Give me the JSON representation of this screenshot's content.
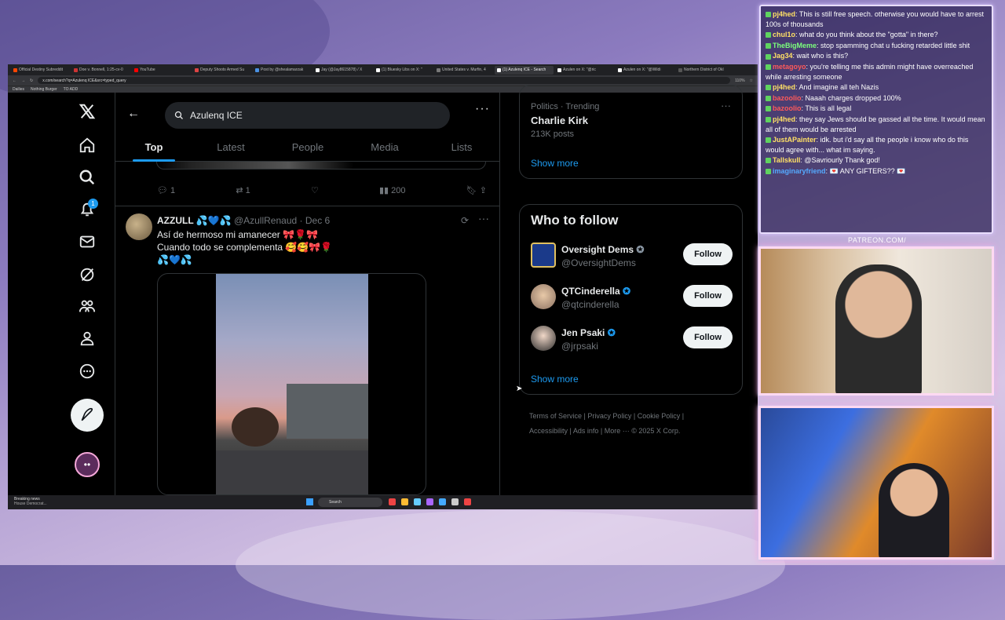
{
  "browser": {
    "tabs": [
      "Official Destiny Subreddit",
      "Doe v. Bonnell, 1:25-cv-0",
      "YouTube",
      "Deputy Shoots Armed Su",
      "Post by @shealamarzak",
      "Jay (@Jay8615878) / X",
      "(1) Bluesky Libs on X: \"",
      "United States v. Murfin, 4",
      "(1) Azulenq ICE - Search",
      "Azulen on X: \"@ric",
      "Azulen on X: \"@Wildi",
      "Northern District of Okl"
    ],
    "active_tab": 8,
    "url": "x.com/search?q=Azulenq ICE&src=typed_query",
    "zoom": "110%",
    "bookmarks": [
      "Dailies",
      "Nothing Burger",
      "TO ADD"
    ]
  },
  "nav": {
    "notification_count": "1"
  },
  "search": {
    "query": "Azulenq ICE"
  },
  "tabs": [
    "Top",
    "Latest",
    "People",
    "Media",
    "Lists"
  ],
  "prev_post": {
    "replies": "1",
    "reposts": "1",
    "views": "200"
  },
  "post": {
    "name": "AZZULL 💦💙💦",
    "handle": "@AzullRenaud",
    "date": "Dec 6",
    "line1": "Así de hermoso mi amanecer 🎀🌹🎀",
    "line2": "Cuando todo se complementa 🥰🥰🎀🌹",
    "line3": "💦💙💦"
  },
  "trending": {
    "meta": "Politics · Trending",
    "topic": "Charlie Kirk",
    "posts": "213K posts",
    "show_more": "Show more"
  },
  "who_to_follow": {
    "title": "Who to follow",
    "accounts": [
      {
        "name": "Oversight Dems",
        "handle": "@OversightDems",
        "button": "Follow"
      },
      {
        "name": "QTCinderella",
        "handle": "@qtcinderella",
        "button": "Follow"
      },
      {
        "name": "Jen Psaki",
        "handle": "@jrpsaki",
        "button": "Follow"
      }
    ],
    "show_more": "Show more"
  },
  "footer": {
    "links": [
      "Terms of Service",
      "Privacy Policy",
      "Cookie Policy",
      "Accessibility",
      "Ads info",
      "More ···"
    ],
    "copyright": "© 2025 X Corp."
  },
  "taskbar": {
    "news_title": "Breaking news",
    "news_sub": "House Democrat...",
    "search": "Search"
  },
  "chat": [
    {
      "user": "pj4hed",
      "color": "#ffe066",
      "text": "This is still free speech. otherwise you would have to arrest 100s of thousands"
    },
    {
      "user": "chul1o",
      "color": "#ffe066",
      "text": "what do you think about the \"gotta\" in there?"
    },
    {
      "user": "TheBigMeme",
      "color": "#7cff7c",
      "text": "stop spamming chat u fucking retarded little shit"
    },
    {
      "user": "Jag34",
      "color": "#ffe066",
      "text": "wait who is this?"
    },
    {
      "user": "metagoyo",
      "color": "#ff5a5a",
      "text": "you're telling me this admin might have overreached while arresting someone"
    },
    {
      "user": "pj4hed",
      "color": "#ffe066",
      "text": "And imagine all teh Nazis"
    },
    {
      "user": "bazoolio",
      "color": "#ff5a5a",
      "text": "Naaah charges dropped 100%"
    },
    {
      "user": "bazoolio",
      "color": "#ff5a5a",
      "text": "This is all legal"
    },
    {
      "user": "pj4hed",
      "color": "#ffe066",
      "text": "they say Jews should be gassed all the time. It would mean all of them would be arrested"
    },
    {
      "user": "JustAPainter",
      "color": "#ffe066",
      "text": "idk. but i'd say all the people i know who do this would agree with... what im saying."
    },
    {
      "user": "Tallskull",
      "color": "#ffe066",
      "text": "@Savriourly Thank god!"
    },
    {
      "user": "imaginaryfriend",
      "color": "#5af",
      "text": "💌 ANY GIFTERS?? 💌"
    }
  ],
  "overlay": {
    "patreon": "PATREON.COM/"
  }
}
